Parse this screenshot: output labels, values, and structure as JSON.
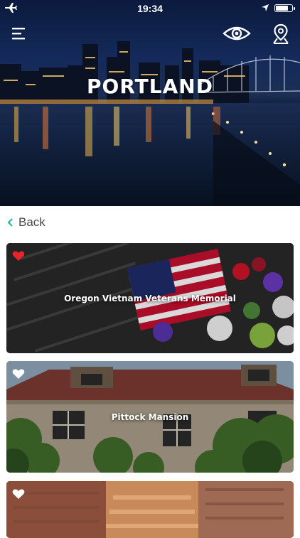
{
  "status_bar": {
    "time": "19:34",
    "icons": [
      "airplane-icon",
      "location-arrow-icon",
      "battery-icon"
    ]
  },
  "header": {
    "city_title": "PORTLAND",
    "icons": [
      "menu-icon",
      "eye-icon",
      "map-pin-icon"
    ]
  },
  "nav": {
    "back_label": "Back"
  },
  "places": [
    {
      "title": "Oregon Vietnam Veterans Memorial",
      "favorite": true
    },
    {
      "title": "Pittock Mansion",
      "favorite": false
    },
    {
      "title": "",
      "favorite": false
    }
  ],
  "colors": {
    "accent": "#1bb99a",
    "heart_active": "#e8232c",
    "heart_inactive": "#ffffff",
    "text_dark": "#4a4a4a"
  }
}
